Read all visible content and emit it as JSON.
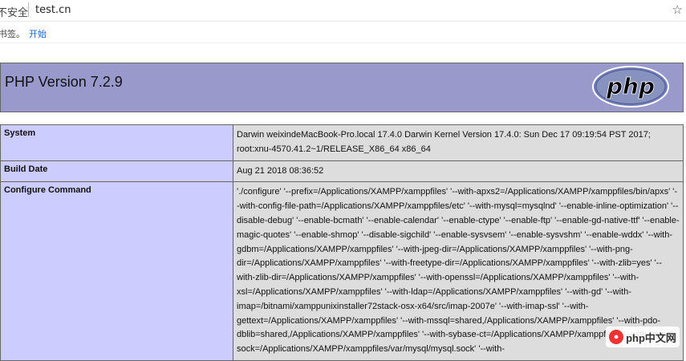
{
  "browser": {
    "security_label": "不安全",
    "url": "test.cn",
    "bookmark_text": "书签。",
    "bookmark_start": "开始"
  },
  "header": {
    "title": "PHP Version 7.2.9",
    "logo_text": "php"
  },
  "rows": [
    {
      "label": "System",
      "value": "Darwin weixindeMacBook-Pro.local 17.4.0 Darwin Kernel Version 17.4.0: Sun Dec 17 09:19:54 PST 2017; root:xnu-4570.41.2~1/RELEASE_X86_64 x86_64"
    },
    {
      "label": "Build Date",
      "value": "Aug 21 2018 08:36:52"
    },
    {
      "label": "Configure Command",
      "value": "'./configure' '--prefix=/Applications/XAMPP/xamppfiles' '--with-apxs2=/Applications/XAMPP/xamppfiles/bin/apxs' '--with-config-file-path=/Applications/XAMPP/xamppfiles/etc' '--with-mysql=mysqlnd' '--enable-inline-optimization' '--disable-debug' '--enable-bcmath' '--enable-calendar' '--enable-ctype' '--enable-ftp' '--enable-gd-native-ttf' '--enable-magic-quotes' '--enable-shmop' '--disable-sigchild' '--enable-sysvsem' '--enable-sysvshm' '--enable-wddx' '--with-gdbm=/Applications/XAMPP/xamppfiles' '--with-jpeg-dir=/Applications/XAMPP/xamppfiles' '--with-png-dir=/Applications/XAMPP/xamppfiles' '--with-freetype-dir=/Applications/XAMPP/xamppfiles' '--with-zlib=yes' '--with-zlib-dir=/Applications/XAMPP/xamppfiles' '--with-openssl=/Applications/XAMPP/xamppfiles' '--with-xsl=/Applications/XAMPP/xamppfiles' '--with-ldap=/Applications/XAMPP/xamppfiles' '--with-gd' '--with-imap=/bitnami/xamppunixinstaller72stack-osx-x64/src/imap-2007e' '--with-imap-ssl' '--with-gettext=/Applications/XAMPP/xamppfiles' '--with-mssql=shared,/Applications/XAMPP/xamppfiles' '--with-pdo-dblib=shared,/Applications/XAMPP/xamppfiles' '--with-sybase-ct=/Applications/XAMPP/xamppfiles' '--with-mysql-sock=/Applications/XAMPP/xamppfiles/var/mysql/mysql.sock' '--with-"
    }
  ],
  "watermark": "php中文网",
  "colors": {
    "header_bg": "#9999cc",
    "label_bg": "#ccccff",
    "value_bg": "#dddddd"
  },
  "icons": {
    "bookmark_star": "star-icon"
  }
}
